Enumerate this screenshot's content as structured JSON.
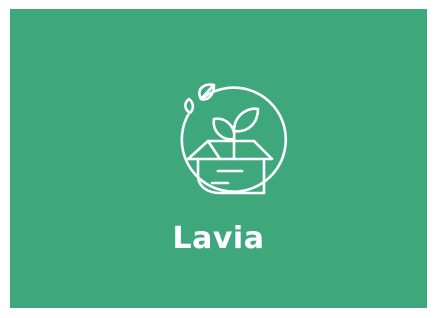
{
  "brand": {
    "name": "Lavia",
    "icon": "sprout-box-logo-icon"
  },
  "colors": {
    "background": "#3ea87c",
    "foreground": "#ffffff"
  }
}
